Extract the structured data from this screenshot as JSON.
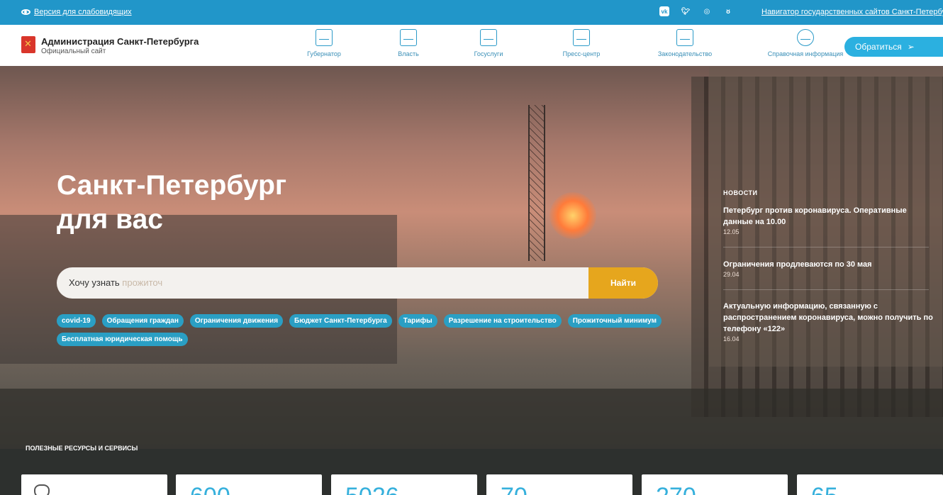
{
  "topbar": {
    "low_vision": "Версия для слабовидящих",
    "navigator": "Навигатор государственных сайтов Санкт-Петербурга",
    "socials": [
      "vk-icon",
      "twitter-icon",
      "instagram-icon",
      "odnoklassniki-icon"
    ]
  },
  "header": {
    "title": "Администрация Санкт-Петербурга",
    "subtitle": "Официальный сайт",
    "nav": [
      "Губернатор",
      "Власть",
      "Госуслуги",
      "Пресс-центр",
      "Законодательство",
      "Справочная информация"
    ],
    "cta": "Обратиться"
  },
  "hero": {
    "title_line1": "Санкт-Петербург",
    "title_line2": "для вас",
    "search_prefix": "Хочу узнать",
    "search_placeholder": "прожиточ",
    "search_button": "Найти",
    "tags": [
      "covid-19",
      "Обращения граждан",
      "Ограничения движения",
      "Бюджет Санкт-Петербурга",
      "Тарифы",
      "Разрешение на строительство",
      "Прожиточный минимум",
      "Бесплатная юридическая помощь"
    ]
  },
  "news": {
    "label": "НОВОСТИ",
    "items": [
      {
        "title": "Петербург против коронавируса. Оперативные данные на 10.00",
        "date": "12.05"
      },
      {
        "title": "Ограничения продлеваются по 30 мая",
        "date": "29.04"
      },
      {
        "title": "Актуальную информацию, связанную с распространением коронавируса, можно получить по телефону «122»",
        "date": "16.04"
      }
    ]
  },
  "resources": {
    "label": "ПОЛЕЗНЫЕ РЕСУРСЫ И СЕРВИСЫ",
    "cards": [
      "",
      "600",
      "5026",
      "70",
      "270",
      "65"
    ]
  },
  "colors": {
    "topbar": "#2196c9",
    "accent": "#2bb0e0",
    "search_button": "#e6a61d",
    "tag": "#2a9fc4"
  }
}
